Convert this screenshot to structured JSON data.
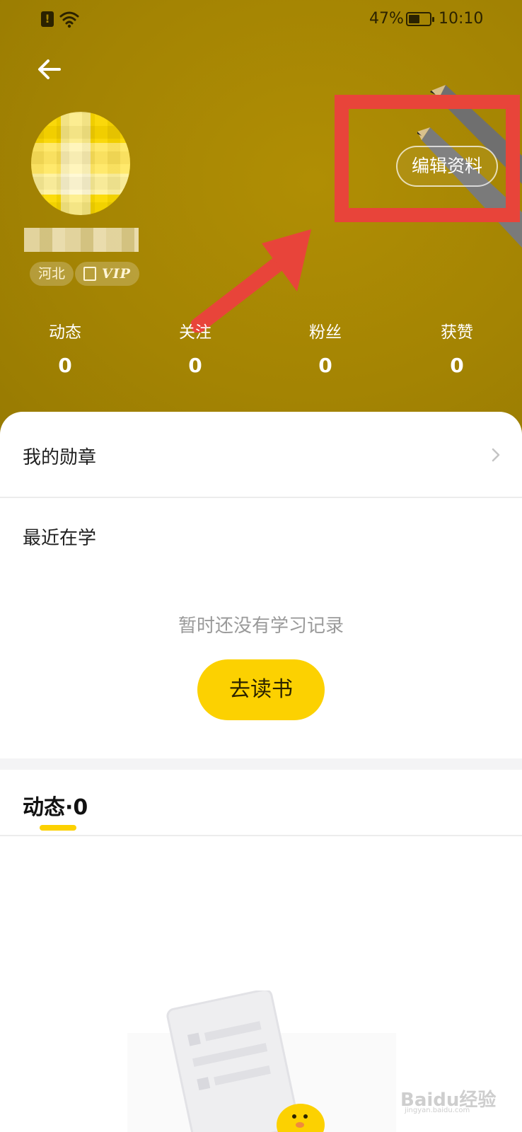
{
  "status_bar": {
    "battery_percent": "47%",
    "battery_level": 0.47,
    "time": "10:10",
    "alert_glyph": "!",
    "icons": [
      "alert-icon",
      "wifi-icon",
      "battery-icon"
    ]
  },
  "header": {
    "back_icon": "arrow-left-icon",
    "edit_profile_label": "编辑资料",
    "tags": {
      "region": "河北",
      "vip": "VIP"
    }
  },
  "stats": [
    {
      "label": "动态",
      "value": "0"
    },
    {
      "label": "关注",
      "value": "0"
    },
    {
      "label": "粉丝",
      "value": "0"
    },
    {
      "label": "获赞",
      "value": "0"
    }
  ],
  "sections": {
    "medals_label": "我的勋章",
    "recent_title": "最近在学",
    "empty_text": "暂时还没有学习记录",
    "read_button_label": "去读书"
  },
  "feed": {
    "tab_label": "动态·0"
  },
  "watermark": {
    "brand": "Baidu经验",
    "url": "jingyan.baidu.com"
  },
  "colors": {
    "hero_background": "#a48403",
    "accent_yellow": "#fcd101",
    "annotation_red": "#e8443a"
  }
}
